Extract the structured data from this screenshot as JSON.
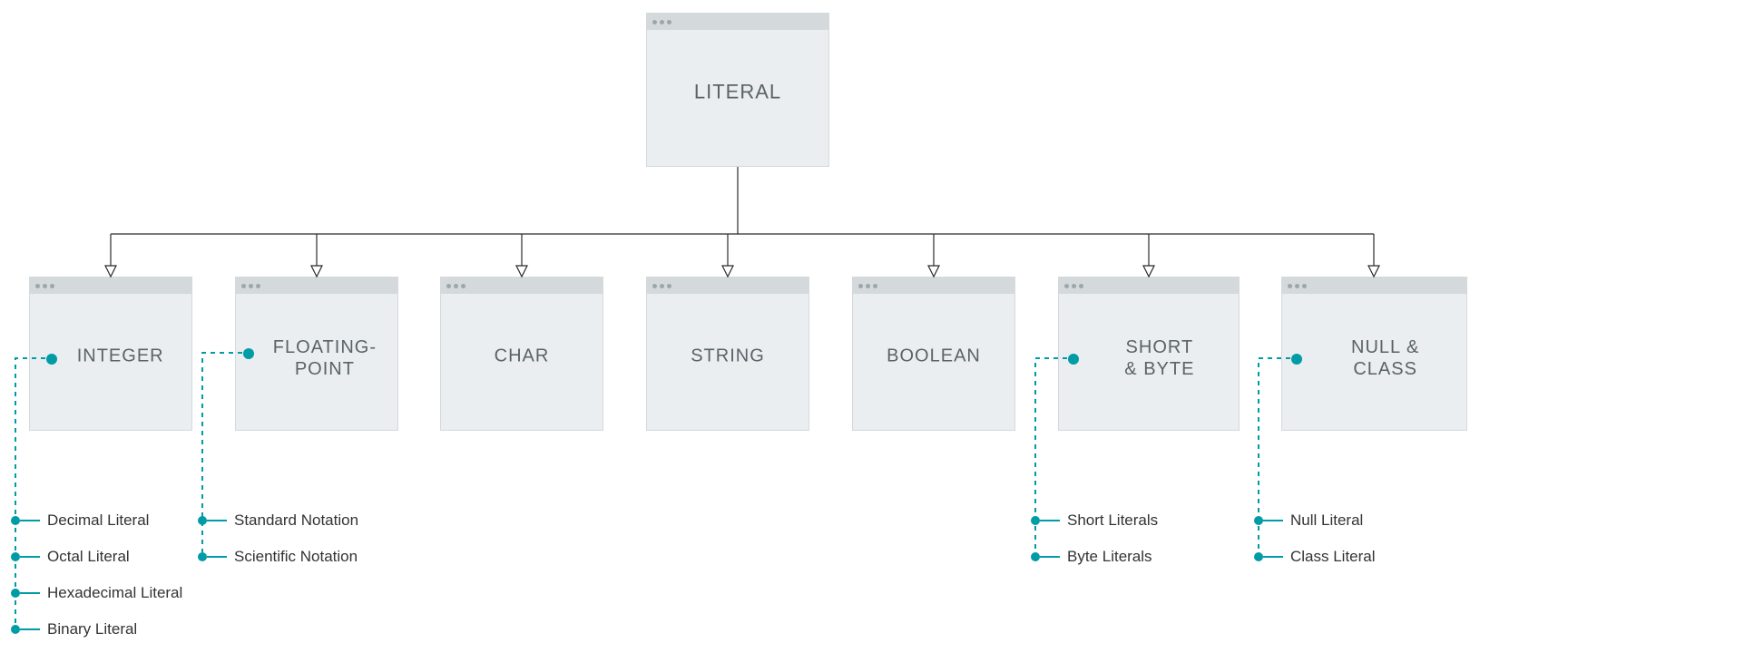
{
  "root": {
    "label": "LITERAL"
  },
  "children": [
    {
      "key": "integer",
      "label": "INTEGER",
      "bullet": true,
      "subs": [
        "Decimal Literal",
        "Octal Literal",
        "Hexadecimal Literal",
        "Binary Literal"
      ]
    },
    {
      "key": "floating-point",
      "label": "FLOATING-\nPOINT",
      "bullet": true,
      "subs": [
        "Standard Notation",
        "Scientific Notation"
      ]
    },
    {
      "key": "char",
      "label": "CHAR",
      "bullet": false,
      "subs": []
    },
    {
      "key": "string",
      "label": "STRING",
      "bullet": false,
      "subs": []
    },
    {
      "key": "boolean",
      "label": "BOOLEAN",
      "bullet": false,
      "subs": []
    },
    {
      "key": "short-byte",
      "label": "SHORT & BYTE",
      "bullet": true,
      "subs": [
        "Short Literals",
        "Byte Literals"
      ]
    },
    {
      "key": "null-class",
      "label": "NULL & CLASS",
      "bullet": true,
      "subs": [
        "Null Literal",
        "Class Literal"
      ]
    }
  ],
  "colors": {
    "accent": "#009ca6",
    "box": "#eaeef1",
    "boxBorder": "#d4d9dc",
    "text": "#5a6368"
  }
}
